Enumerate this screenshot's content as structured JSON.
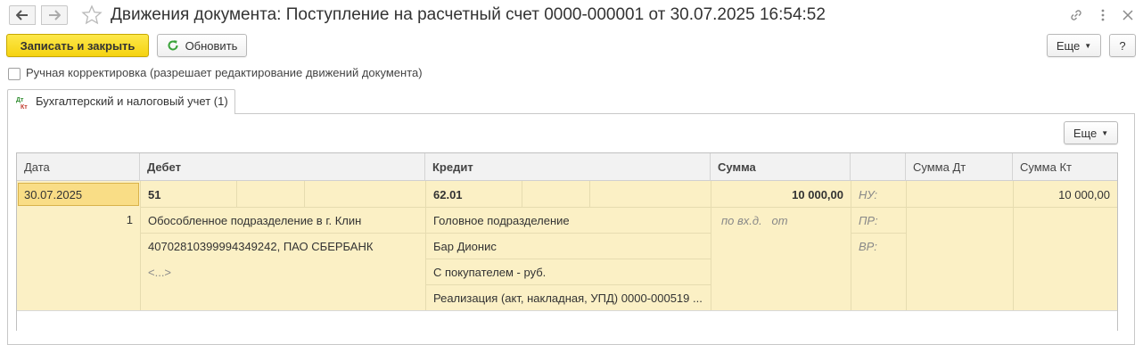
{
  "window": {
    "title": "Движения документа: Поступление на расчетный счет 0000-000001 от 30.07.2025 16:54:52"
  },
  "toolbar": {
    "save_close_label": "Записать и закрыть",
    "refresh_label": "Обновить",
    "more_label": "Еще",
    "help_label": "?"
  },
  "manual_adjust": {
    "checked": false,
    "label": "Ручная корректировка (разрешает редактирование движений документа)"
  },
  "tabs": [
    {
      "label": "Бухгалтерский и налоговый учет (1)",
      "icon_text": [
        "Дт",
        "Кт"
      ],
      "active": true
    }
  ],
  "panel": {
    "more_label": "Еще"
  },
  "table": {
    "columns": [
      "Дата",
      "Дебет",
      "Кредит",
      "Сумма",
      "",
      "Сумма Дт",
      "Сумма Кт"
    ],
    "rows": [
      {
        "date": "30.07.2025",
        "line_no": "1",
        "debit": {
          "account": "51",
          "subconto": [
            "Обособленное подразделение в г. Клин",
            "40702810399994349242, ПАО СБЕРБАНК",
            "<...>"
          ]
        },
        "credit": {
          "account": "62.01",
          "subconto": [
            "Головное подразделение",
            "Бар Дионис",
            "С покупателем - руб.",
            "Реализация (акт, накладная, УПД) 0000-000519 ..."
          ]
        },
        "amount": "10 000,00",
        "currency_note": "по вх.д.   от",
        "tax_labels": [
          "НУ:",
          "ПР:",
          "ВР:"
        ],
        "amount_dt": "",
        "amount_kt": "10 000,00"
      }
    ]
  },
  "colors": {
    "primary_button": "#f5d311",
    "row_highlight": "#fbf0c5",
    "selected_cell": "#f9dd86"
  }
}
